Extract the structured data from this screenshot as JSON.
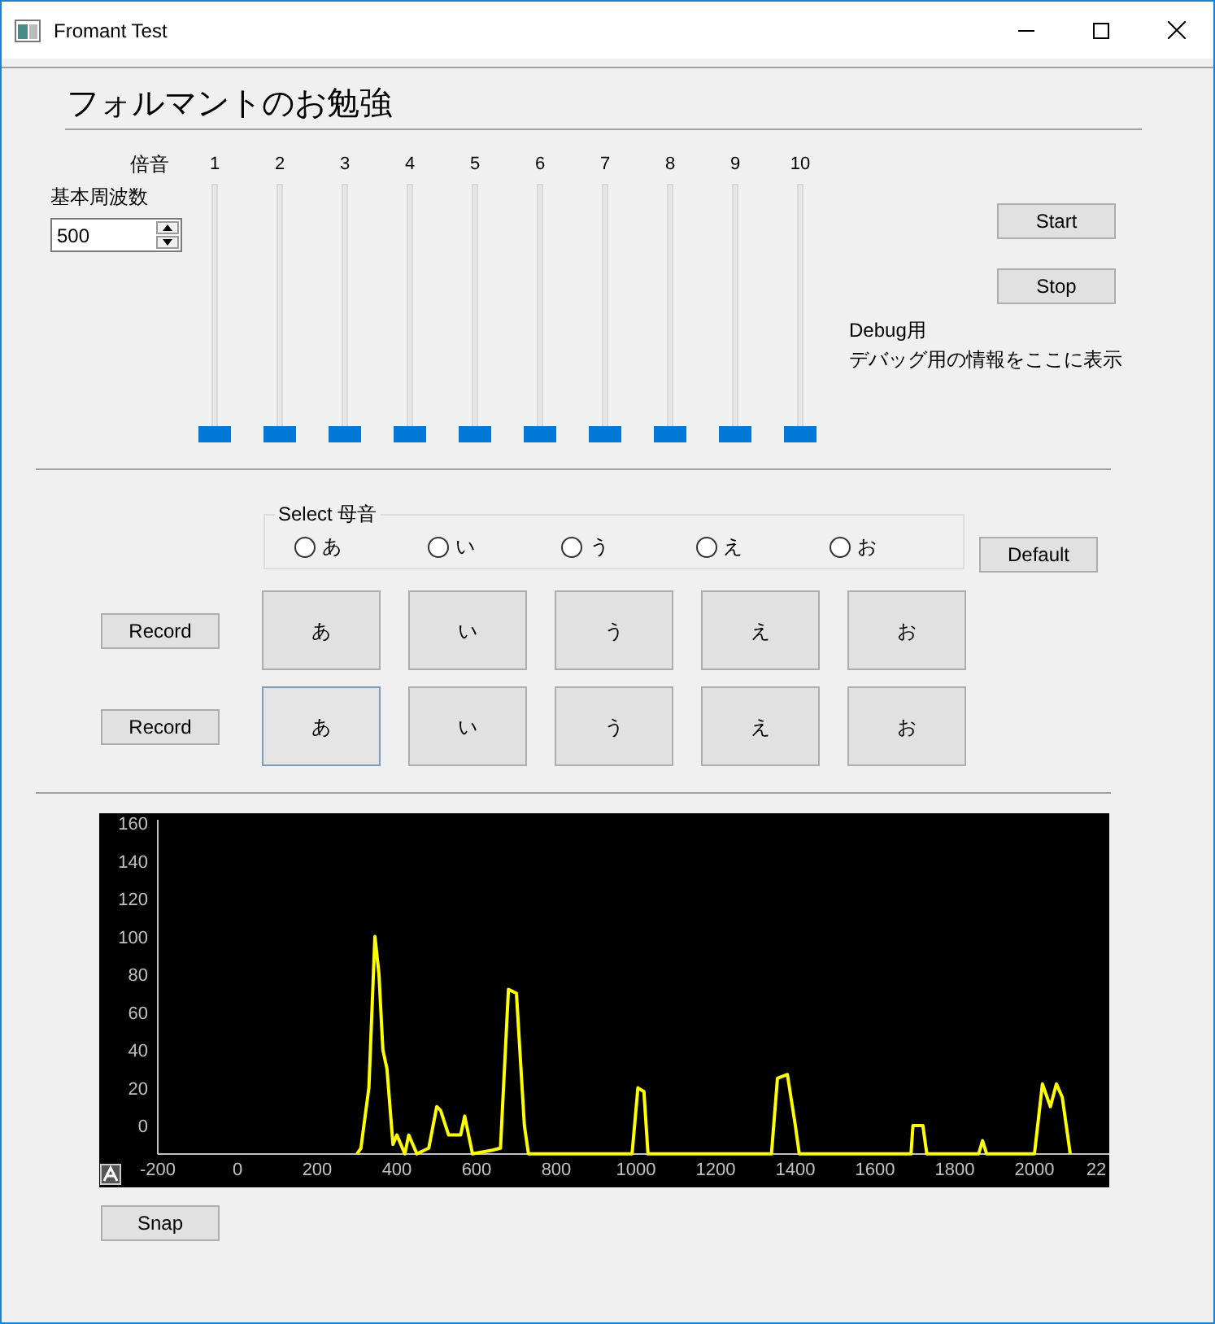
{
  "window": {
    "title": "Fromant Test"
  },
  "heading": "フォルマントのお勉強",
  "harmonics": {
    "label": "倍音",
    "sliders": [
      {
        "label": "1",
        "level": 0
      },
      {
        "label": "2",
        "level": 0
      },
      {
        "label": "3",
        "level": 0
      },
      {
        "label": "4",
        "level": 0
      },
      {
        "label": "5",
        "level": 0
      },
      {
        "label": "6",
        "level": 0
      },
      {
        "label": "7",
        "level": 0
      },
      {
        "label": "8",
        "level": 0
      },
      {
        "label": "9",
        "level": 0
      },
      {
        "label": "10",
        "level": 0
      }
    ]
  },
  "fundamental": {
    "label": "基本周波数",
    "value": "500"
  },
  "control_buttons": [
    "Start",
    "Stop"
  ],
  "debug": {
    "title": "Debug用",
    "message": "デバッグ用の情報をここに表示"
  },
  "vowel_select": {
    "legend": "Select 母音",
    "options": [
      {
        "label": "あ",
        "selected": false
      },
      {
        "label": "い",
        "selected": false
      },
      {
        "label": "う",
        "selected": false
      },
      {
        "label": "え",
        "selected": false
      },
      {
        "label": "お",
        "selected": false
      }
    ]
  },
  "default_button": "Default",
  "record_rows": [
    {
      "record_label": "Record",
      "vowels": [
        {
          "label": "あ",
          "focused": false
        },
        {
          "label": "い",
          "focused": false
        },
        {
          "label": "う",
          "focused": false
        },
        {
          "label": "え",
          "focused": false
        },
        {
          "label": "お",
          "focused": false
        }
      ]
    },
    {
      "record_label": "Record",
      "vowels": [
        {
          "label": "あ",
          "focused": true
        },
        {
          "label": "い",
          "focused": false
        },
        {
          "label": "う",
          "focused": false
        },
        {
          "label": "え",
          "focused": false
        },
        {
          "label": "お",
          "focused": false
        }
      ]
    }
  ],
  "spectrum": {
    "y_axis_labels": [
      "160",
      "140",
      "120",
      "100",
      "80",
      "60",
      "40",
      "20",
      "0"
    ],
    "x_axis_labels": [
      "-200",
      "0",
      "200",
      "400",
      "600",
      "800",
      "1000",
      "1200",
      "1400",
      "1600",
      "1800",
      "2000",
      "22"
    ]
  },
  "snap_button": "Snap"
}
